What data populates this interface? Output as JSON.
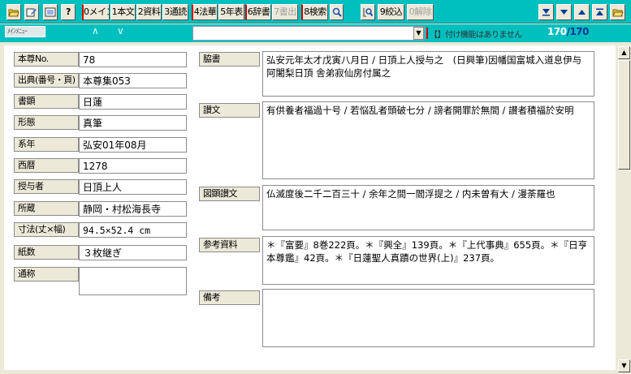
{
  "toolbar": {
    "icons": {
      "open": "open-folder-icon",
      "edit": "edit-record-icon",
      "list": "list-icon",
      "help": "help-icon",
      "search_glass": "search-magnifier-icon",
      "search_filter": "filter-search-icon",
      "folder_right": "open-folder-icon"
    },
    "buttons": {
      "main": "0メイン",
      "honbun": "1本文",
      "shiryo": "2資料",
      "tsuudoku": "3通読",
      "hokke": "4法華",
      "nenpyo": "5年表",
      "jisho": "6辞書",
      "kakidashi": "7書出",
      "kensaku": "8検索",
      "shiborikomi": "9絞込",
      "kaijo": "0解除"
    },
    "nav": {
      "last": "▼̲",
      "next": "▼",
      "prev": "▲",
      "first": "▲̅"
    }
  },
  "navbar": {
    "menu_tab": "ﾒｲﾝﾒﾆｭｰ",
    "up": "∧",
    "down": "∨",
    "search_value": "",
    "bookmark_status": "【】付け機能はありません",
    "current": "170",
    "total": "/170"
  },
  "record": {
    "left": [
      {
        "label": "本尊No.",
        "value": "78"
      },
      {
        "label": "出典(番号・頁)",
        "value": "本尊集053"
      },
      {
        "label": "書顕",
        "value": "日蓮"
      },
      {
        "label": "形態",
        "value": "真筆"
      },
      {
        "label": "系年",
        "value": "弘安01年08月"
      },
      {
        "label": "西暦",
        "value": "1278"
      },
      {
        "label": "授与者",
        "value": "日頂上人"
      },
      {
        "label": "所蔵",
        "value": "静岡・村松海長寺"
      },
      {
        "label": "寸法(丈×幅)",
        "value": "94.5×52.4 cm"
      },
      {
        "label": "紙数",
        "value": "３枚継ぎ"
      },
      {
        "label": "通称",
        "value": ""
      }
    ],
    "right": [
      {
        "label": "脇書",
        "value": "弘安元年太才戊寅八月日 / 日頂上人授与之　(日興筆)因幡国富城入道息伊与阿闍梨日頂 舎弟寂仙房付属之"
      },
      {
        "label": "讃文",
        "value": "有供養者福過十号 / 若悩乱者頭破七分 / 謗者開罪於無間 / 讃者積福於安明"
      },
      {
        "label": "図顕讃文",
        "value": "仏滅度後二千二百三十 / 余年之間一閻浮提之 / 内未曽有大 / 漫荼羅也"
      },
      {
        "label": "参考資料",
        "value": "＊『富要』8巻222頁。＊『興全』139頁。＊『上代事典』655頁。＊『日亨本尊鑑』42頁。＊『日蓮聖人真蹟の世界(上)』237頁。"
      },
      {
        "label": "備考",
        "value": ""
      }
    ]
  },
  "colors": {
    "toolbar_bg": "#00bfbf",
    "counter_current": "#ffffff",
    "counter_total": "#003a9a",
    "separator_red": "#d00000"
  }
}
